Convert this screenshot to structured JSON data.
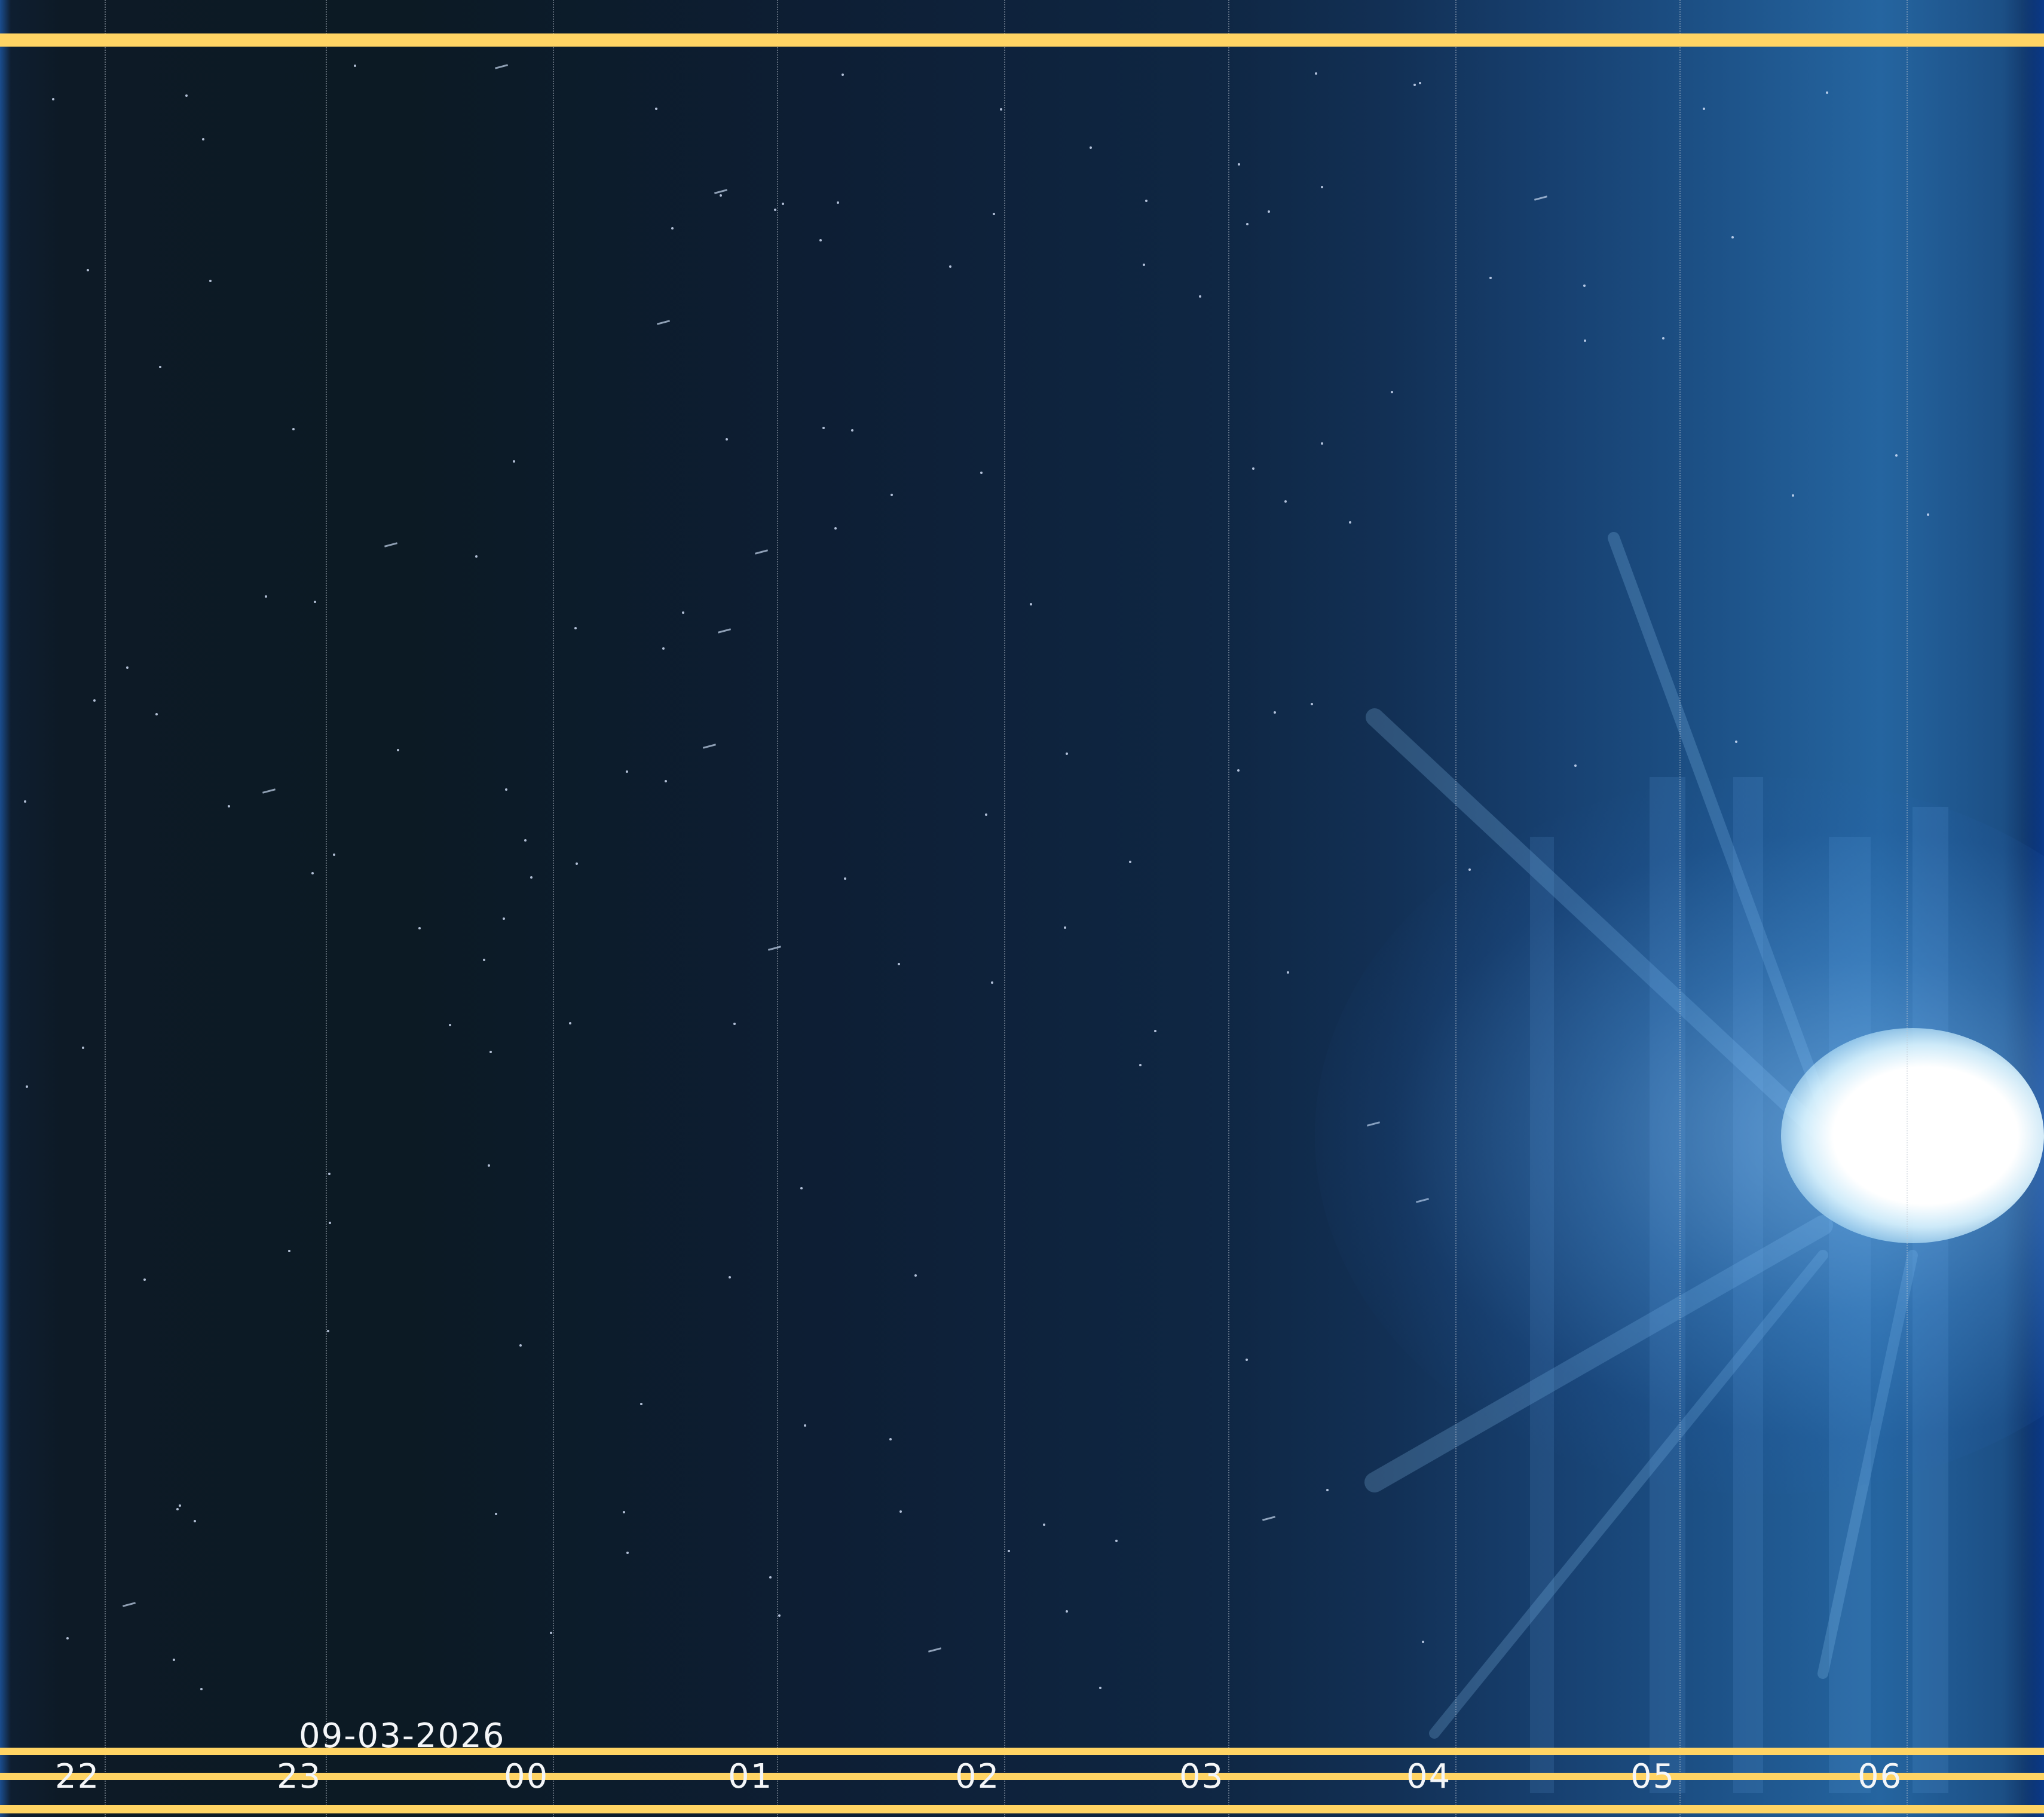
{
  "timelapse": {
    "date": "09-03-2026",
    "hours": [
      "22",
      "23",
      "00",
      "01",
      "02",
      "03",
      "04",
      "05",
      "06"
    ]
  },
  "colors": {
    "band": "#ffd464",
    "sky_night": "#0c1a24",
    "sky_dawn": "#2565a0",
    "label_text": "#f4f6f8"
  }
}
